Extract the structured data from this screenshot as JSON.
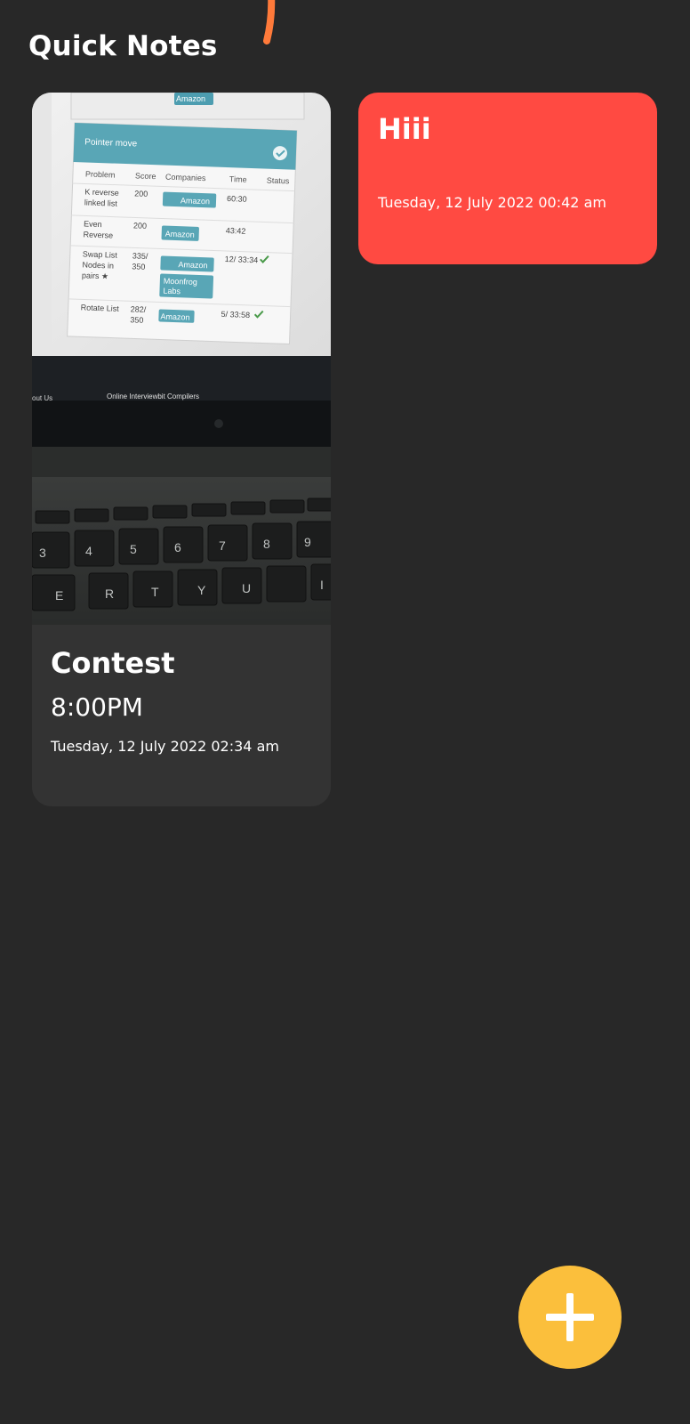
{
  "app": {
    "title": "Quick Notes"
  },
  "colors": {
    "background": "#282828",
    "card_default": "#333333",
    "card_red": "#ff4a42",
    "fab": "#fbbf3c",
    "accent_stroke": "#ff7a3a"
  },
  "notes": [
    {
      "title": "Contest",
      "text": "8:00PM",
      "date": "Tuesday, 12 July 2022 02:34 am",
      "has_image": true,
      "image_text": {
        "header": "Pointer move",
        "columns": [
          "Problem",
          "Score",
          "Companies",
          "Time",
          "Status"
        ],
        "rows": [
          {
            "problem": "K reverse linked list",
            "score": "200",
            "companies": [
              "Amazon"
            ],
            "time": "60:30"
          },
          {
            "problem": "Even Reverse",
            "score": "200",
            "companies": [
              "Amazon"
            ],
            "time": "43:42"
          },
          {
            "problem": "Swap List Nodes in pairs ★",
            "score": "335/ 350",
            "companies": [
              "Amazon",
              "Moonfrog Labs"
            ],
            "time": "12/ 33:34"
          },
          {
            "problem": "Rotate List",
            "score": "282/ 350",
            "companies": [
              "Amazon"
            ],
            "time": "5/ 33:58"
          }
        ],
        "top_tag": "Amazon",
        "footer_left": "out Us",
        "footer_center": "Online Interviewbit Compilers",
        "keys": [
          "3",
          "4",
          "5",
          "6",
          "7",
          "8",
          "9",
          "E",
          "R",
          "T",
          "Y",
          "U",
          "I"
        ]
      }
    },
    {
      "title": "Hiii",
      "date": "Tuesday, 12 July 2022 00:42 am",
      "has_image": false
    }
  ],
  "fab": {
    "icon": "plus-icon"
  }
}
